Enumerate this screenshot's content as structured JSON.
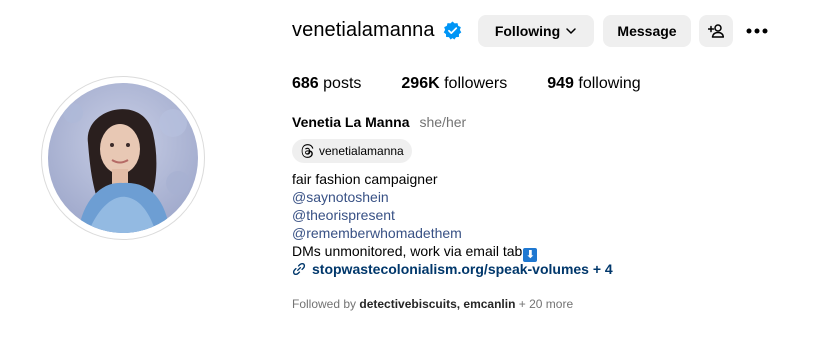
{
  "profile": {
    "username": "venetialamanna",
    "full_name": "Venetia La Manna",
    "pronouns": "she/her",
    "threads_handle": "venetialamanna"
  },
  "actions": {
    "following_label": "Following",
    "message_label": "Message"
  },
  "stats": {
    "posts_count": "686",
    "posts_label": "posts",
    "followers_count": "296K",
    "followers_label": "followers",
    "following_count": "949",
    "following_label": "following"
  },
  "bio": {
    "line1": "fair fashion campaigner",
    "mention1": "@saynotoshein",
    "mention2": "@theorispresent",
    "mention3": "@rememberwhomadethem",
    "line5": "DMs unmonitored, work via email tab",
    "emoji_glyph": "⬇",
    "link": "stopwastecolonialism.org/speak-volumes + 4"
  },
  "followed_by": {
    "prefix": "Followed by",
    "names": "detectivebiscuits, emcanlin",
    "suffix": "+ 20 more"
  },
  "colors": {
    "verified": "#0095f6",
    "button_bg": "#efefef",
    "link": "#00376b",
    "mention": "#385185",
    "muted": "#737373"
  },
  "icons": {
    "verified": "verified-badge-icon",
    "chevron": "chevron-down-icon",
    "suggest": "add-person-icon",
    "more": "more-options-icon",
    "threads": "threads-icon",
    "link": "link-icon"
  }
}
